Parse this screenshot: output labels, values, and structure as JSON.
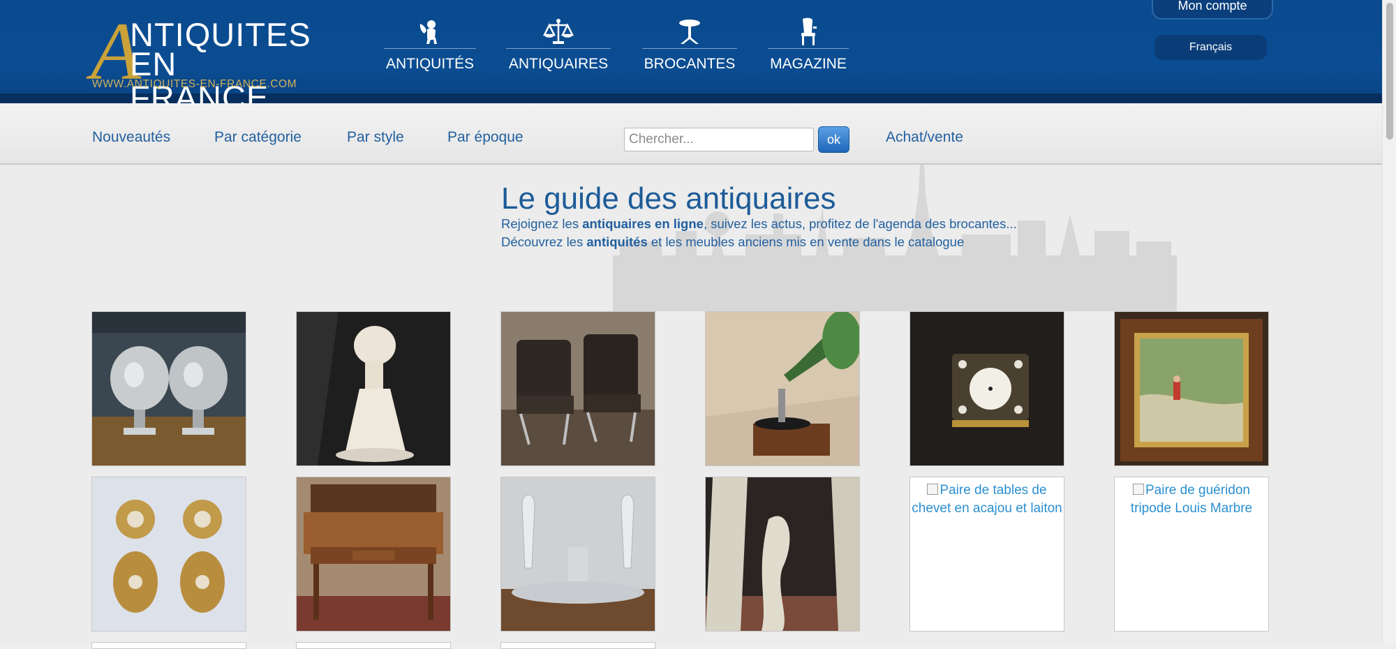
{
  "header": {
    "logo_big_letter": "A",
    "logo_line1": "NTIQUITES",
    "logo_line2": "EN FRANCE",
    "logo_url": "WWW.ANTIQUITES-EN-FRANCE.COM",
    "nav": [
      {
        "label": "ANTIQUITÉS",
        "icon": "cherub-icon"
      },
      {
        "label": "ANTIQUAIRES",
        "icon": "scale-icon"
      },
      {
        "label": "BROCANTES",
        "icon": "gueridon-icon"
      },
      {
        "label": "MAGAZINE",
        "icon": "chair-icon"
      }
    ],
    "account_label": "Mon compte",
    "language_label": "Français"
  },
  "subnav": {
    "links": [
      "Nouveautés",
      "Par catégorie",
      "Par style",
      "Par époque"
    ],
    "search_placeholder": "Chercher...",
    "search_button": "ok",
    "extra_link": "Achat/vente"
  },
  "hero": {
    "title": "Le guide des antiquaires",
    "line1_pre": "Rejoignez les ",
    "line1_bold": "antiquaires en ligne",
    "line1_post": ", suivez les actus, profitez de l'agenda des brocantes...",
    "line2_pre": "Découvrez les ",
    "line2_bold": "antiquités",
    "line2_post": " et les meubles anciens mis en vente dans le catalogue"
  },
  "grid": {
    "broken_tiles": [
      {
        "alt": "Paire de tables de chevet en acajou et laiton"
      },
      {
        "alt": "Paire de guéridon tripode Louis Marbre"
      }
    ]
  },
  "colors": {
    "header_blue": "#0b4d92",
    "link_blue": "#22609f",
    "logo_gold": "#c9a23a"
  }
}
